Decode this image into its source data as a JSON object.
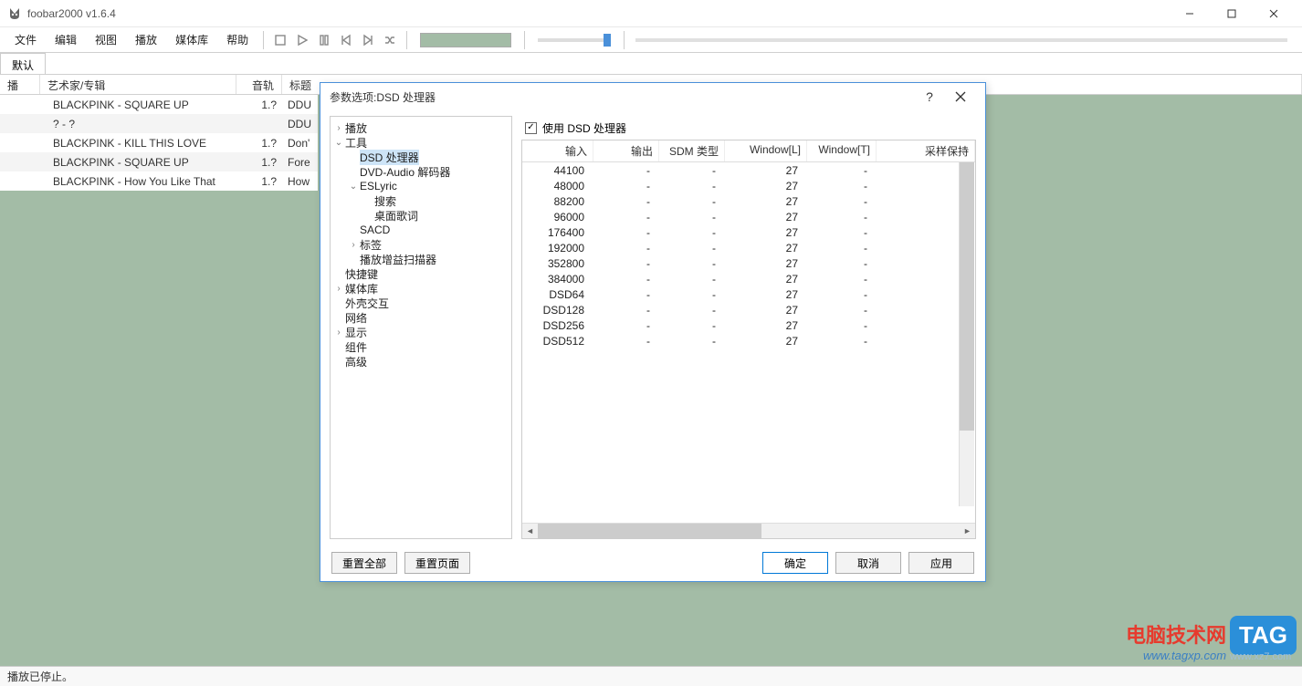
{
  "window": {
    "title": "foobar2000 v1.6.4"
  },
  "menu": [
    "文件",
    "编辑",
    "视图",
    "播放",
    "媒体库",
    "帮助"
  ],
  "tab": {
    "active": "默认"
  },
  "playlist": {
    "headers": {
      "order": "播放…",
      "artist_album": "艺术家/专辑",
      "track": "音轨号",
      "title": "标题"
    },
    "rows": [
      {
        "artist": "BLACKPINK - SQUARE UP",
        "track": "1.?",
        "title": "DDU"
      },
      {
        "artist": "? - ?",
        "track": "",
        "title": "DDU"
      },
      {
        "artist": "BLACKPINK - KILL THIS LOVE",
        "track": "1.?",
        "title": "Don'"
      },
      {
        "artist": "BLACKPINK - SQUARE UP",
        "track": "1.?",
        "title": "Fore"
      },
      {
        "artist": "BLACKPINK - How You Like That",
        "track": "1.?",
        "title": "How"
      }
    ]
  },
  "dialog": {
    "title": "参数选项:DSD 处理器",
    "help_label": "?",
    "tree": [
      {
        "label": "播放",
        "depth": 0,
        "tw": "›"
      },
      {
        "label": "工具",
        "depth": 0,
        "tw": "⌄"
      },
      {
        "label": "DSD 处理器",
        "depth": 1,
        "tw": "",
        "selected": true
      },
      {
        "label": "DVD-Audio 解码器",
        "depth": 1,
        "tw": ""
      },
      {
        "label": "ESLyric",
        "depth": 1,
        "tw": "⌄"
      },
      {
        "label": "搜索",
        "depth": 2,
        "tw": ""
      },
      {
        "label": "桌面歌词",
        "depth": 2,
        "tw": ""
      },
      {
        "label": "SACD",
        "depth": 1,
        "tw": ""
      },
      {
        "label": "标签",
        "depth": 1,
        "tw": "›"
      },
      {
        "label": "播放增益扫描器",
        "depth": 1,
        "tw": ""
      },
      {
        "label": "快捷键",
        "depth": 0,
        "tw": ""
      },
      {
        "label": "媒体库",
        "depth": 0,
        "tw": "›"
      },
      {
        "label": "外壳交互",
        "depth": 0,
        "tw": ""
      },
      {
        "label": "网络",
        "depth": 0,
        "tw": ""
      },
      {
        "label": "显示",
        "depth": 0,
        "tw": "›"
      },
      {
        "label": "组件",
        "depth": 0,
        "tw": ""
      },
      {
        "label": "高级",
        "depth": 0,
        "tw": ""
      }
    ],
    "checkbox": {
      "checked": true,
      "label": "使用 DSD 处理器"
    },
    "grid": {
      "headers": [
        "输入",
        "输出",
        "SDM 类型",
        "Window[L]",
        "Window[T]",
        "采样保持"
      ],
      "rows": [
        {
          "in": "44100",
          "out": "-",
          "sdm": "-",
          "wl": "27",
          "wt": "-",
          "sh": "-"
        },
        {
          "in": "48000",
          "out": "-",
          "sdm": "-",
          "wl": "27",
          "wt": "-",
          "sh": "-"
        },
        {
          "in": "88200",
          "out": "-",
          "sdm": "-",
          "wl": "27",
          "wt": "-",
          "sh": "-"
        },
        {
          "in": "96000",
          "out": "-",
          "sdm": "-",
          "wl": "27",
          "wt": "-",
          "sh": "-"
        },
        {
          "in": "176400",
          "out": "-",
          "sdm": "-",
          "wl": "27",
          "wt": "-",
          "sh": "-"
        },
        {
          "in": "192000",
          "out": "-",
          "sdm": "-",
          "wl": "27",
          "wt": "-",
          "sh": "-"
        },
        {
          "in": "352800",
          "out": "-",
          "sdm": "-",
          "wl": "27",
          "wt": "-",
          "sh": "-"
        },
        {
          "in": "384000",
          "out": "-",
          "sdm": "-",
          "wl": "27",
          "wt": "-",
          "sh": "-"
        },
        {
          "in": "DSD64",
          "out": "-",
          "sdm": "-",
          "wl": "27",
          "wt": "-",
          "sh": "-"
        },
        {
          "in": "DSD128",
          "out": "-",
          "sdm": "-",
          "wl": "27",
          "wt": "-",
          "sh": "-"
        },
        {
          "in": "DSD256",
          "out": "-",
          "sdm": "-",
          "wl": "27",
          "wt": "-",
          "sh": "-"
        },
        {
          "in": "DSD512",
          "out": "-",
          "sdm": "-",
          "wl": "27",
          "wt": "-",
          "sh": "-"
        }
      ]
    },
    "buttons": {
      "reset_all": "重置全部",
      "reset_page": "重置页面",
      "ok": "确定",
      "cancel": "取消",
      "apply": "应用"
    }
  },
  "statusbar": {
    "text": "播放已停止。"
  },
  "watermark": {
    "cn": "电脑技术网",
    "url": "www.tagxp.com",
    "tag": "TAG",
    "xz": "www.xz7.com"
  }
}
